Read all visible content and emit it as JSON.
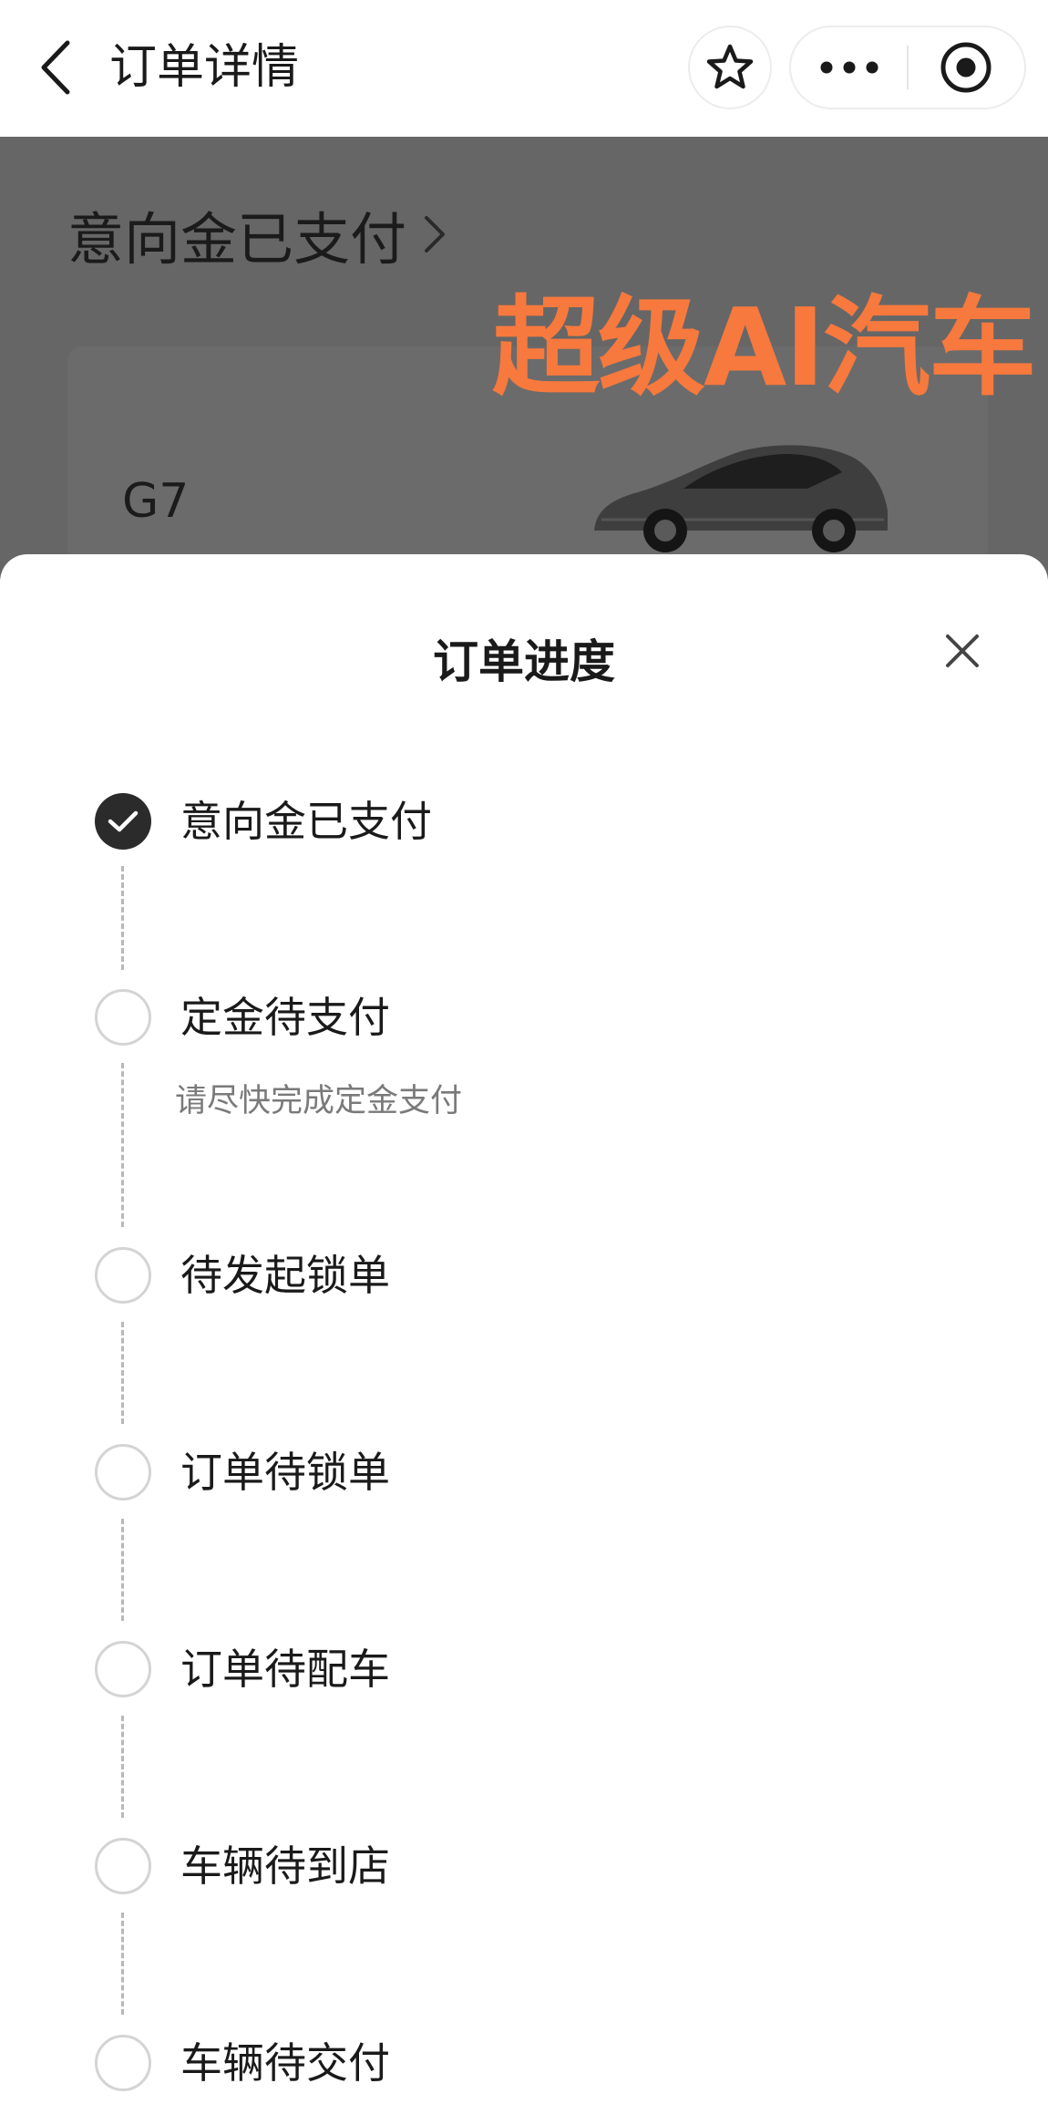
{
  "navbar": {
    "title": "订单详情",
    "back_icon": "chevron-left-icon",
    "star_icon": "star-outline-icon",
    "more_icon": "more-dots-icon",
    "target_icon": "record-target-icon"
  },
  "background_page": {
    "status": "意向金已支付",
    "status_chevron": "chevron-right-icon",
    "model": "G7",
    "watermark": "超级AI汽车",
    "watermark_color": "#f7793d"
  },
  "sheet": {
    "title": "订单进度",
    "close_icon": "close-icon",
    "steps": [
      {
        "label": "意向金已支付",
        "status": "done",
        "note": ""
      },
      {
        "label": "定金待支付",
        "status": "pending",
        "note": "请尽快完成定金支付"
      },
      {
        "label": "待发起锁单",
        "status": "pending",
        "note": ""
      },
      {
        "label": "订单待锁单",
        "status": "pending",
        "note": ""
      },
      {
        "label": "订单待配车",
        "status": "pending",
        "note": ""
      },
      {
        "label": "车辆待到店",
        "status": "pending",
        "note": ""
      },
      {
        "label": "车辆待交付",
        "status": "pending",
        "note": ""
      }
    ]
  },
  "colors": {
    "overlay": "#666666",
    "done_dot": "#2b2b2b",
    "pending_ring": "#d4d4d4",
    "connector": "#b8b8b8"
  }
}
